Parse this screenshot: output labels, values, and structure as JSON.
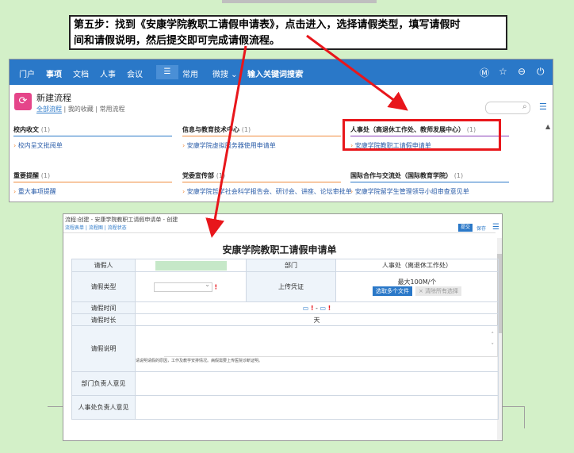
{
  "caption": {
    "line1": "第五步：找到《安康学院教职工请假申请表》，点击进入，选择请假类型，填写请假时",
    "line2": "间和请假说明，然后提交即可完成请假流程。"
  },
  "appbar": {
    "nav": [
      "门户",
      "事项",
      "文档",
      "人事",
      "会议"
    ],
    "menu_label": "常用",
    "search_scope": "微搜",
    "search_placeholder": "输入关键词搜索"
  },
  "header": {
    "title": "新建流程",
    "tabs": [
      "全部流程",
      "我的收藏",
      "常用流程"
    ]
  },
  "sections": [
    {
      "title": "校内收文",
      "count": "(1)",
      "item": "校内呈文批阅单"
    },
    {
      "title": "信息与教育技术中心",
      "count": "(1)",
      "item": "安康学院虚拟服务器使用申请单"
    },
    {
      "title": "人事处（高退休工作处、教师发展中心）",
      "count": "(1)",
      "item": "安康学院教职工请假申请单"
    },
    {
      "title": "重要提醒",
      "count": "(1)",
      "item": "重大事项提醒"
    },
    {
      "title": "党委宣传部",
      "count": "(1)",
      "item": "安康学院哲学社会科学报告会、研讨会、讲座、论坛审批单"
    },
    {
      "title": "国际合作与交流处（国际教育学院）",
      "count": "(1)",
      "item": "安康学院留学生管理领导小组审查意见单"
    }
  ],
  "form_window": {
    "title_bar": "流程:创建 - 安康学院教职工请假申请单 - 创建",
    "subnav": "流程表单 | 流程图 | 流程状态",
    "submit_label": "提交",
    "save_label": "保存",
    "form_title": "安康学院教职工请假申请单",
    "fields": {
      "applicant_label": "请假人",
      "dept_label": "部门",
      "dept_value": "人事处（离退休工作处）",
      "type_label": "请假类型",
      "upload_label": "上传凭证",
      "upload_limit": "最大100M/个",
      "upload_button": "选取多个文件",
      "clear_button": "清除所有选择",
      "time_label": "请假时间",
      "date_sep": "-",
      "duration_label": "请假时长",
      "duration_unit": "天",
      "reason_label": "请假说明",
      "reason_hint": "请说明请假的原因，工作及教学安排情况。病假需要上传医院诊断证明。",
      "dept_opinion_label": "部门负责人意见",
      "hr_opinion_label": "人事处负责人意见"
    }
  },
  "colors": {
    "background": "#d3f0c8",
    "accent_blue": "#2a78c8",
    "highlight_red": "#e8161b"
  }
}
